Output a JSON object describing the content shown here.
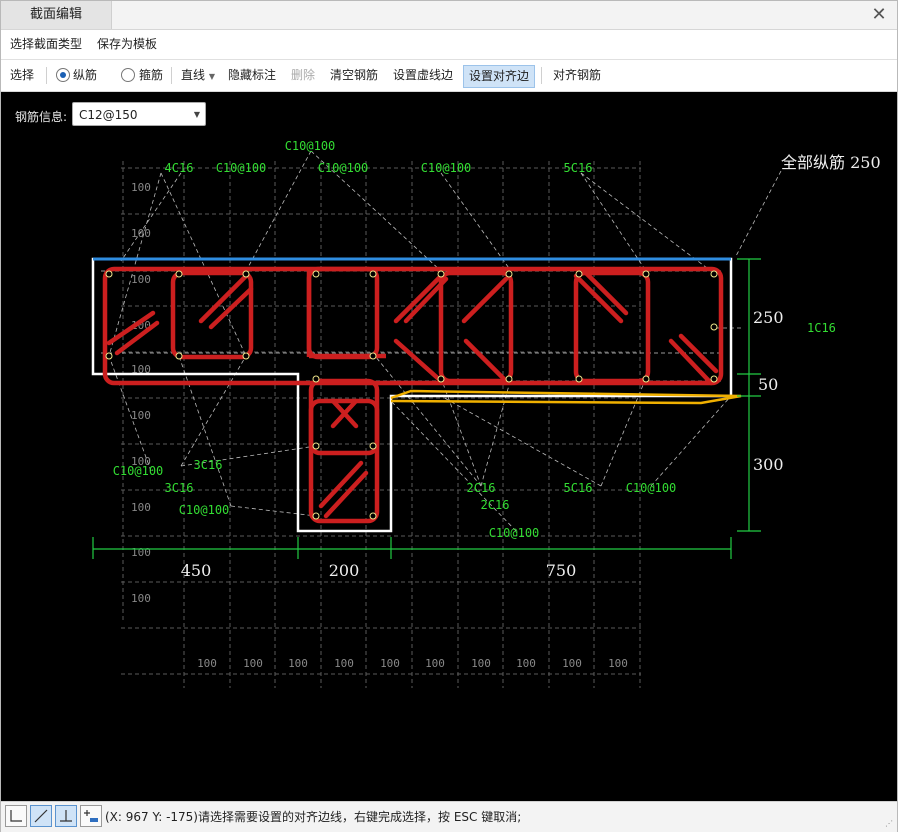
{
  "window": {
    "title": "截面编辑"
  },
  "menu": {
    "select_section_type": "选择截面类型",
    "save_template": "保存为模板"
  },
  "toolbar": {
    "select": "选择",
    "longitudinal": "纵筋",
    "stirrup": "箍筋",
    "line": "直线",
    "hide_labels": "隐藏标注",
    "delete": "删除",
    "clear_rebar": "清空钢筋",
    "set_dashed_edge": "设置虚线边",
    "set_align_edge": "设置对齐边",
    "align_rebar": "对齐钢筋",
    "selected_mode": "纵筋"
  },
  "rebar_info": {
    "label": "钢筋信息:",
    "value": "C12@150"
  },
  "drawing": {
    "total_label": "全部纵筋  250",
    "dim_horizontal": [
      "450",
      "200",
      "750"
    ],
    "dim_vertical": [
      "250",
      "50",
      "300"
    ],
    "grid_step_label": "100",
    "rebar_labels": {
      "top_c10_a": "C10@100",
      "top_4c16": "4C16",
      "top_c10_b": "C10@100",
      "top_c10_c": "C10@100",
      "top_c10_d": "C10@100",
      "top_5c16": "5C16",
      "right_1c16": "1C16",
      "left_c10": "C10@100",
      "left_3c16_a": "3C16",
      "left_3c16_b": "3C16",
      "left_c10_b": "C10@100",
      "mid_2c16_a": "2C16",
      "mid_2c16_b": "2C16",
      "right_5c16": "5C16",
      "right_c10": "C10@100",
      "bottom_c10": "C10@100"
    },
    "colors": {
      "background": "#000000",
      "rebar": "#cc1f1f",
      "label": "#33dd33",
      "align_edge": "#2f8de0",
      "selected_edge": "#f0b000",
      "outline": "#ffffff",
      "grid": "#5a5a5a"
    }
  },
  "status": {
    "coords": "(X: 967 Y: -175)",
    "message": "请选择需要设置的对齐边线，右键完成选择，按 ESC 键取消;"
  }
}
